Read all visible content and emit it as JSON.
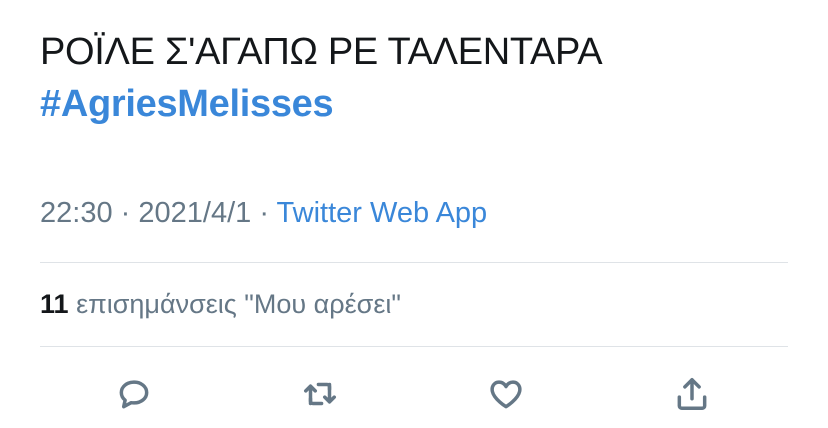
{
  "tweet": {
    "text_line1": "ΡΟΪΛΕ Σ'ΑΓΑΠΩ ΡΕ ΤΑΛΕΝΤΑΡΑ",
    "hashtag": "#AgriesMelisses",
    "time": "22:30",
    "separator": "·",
    "date": "2021/4/1",
    "source": "Twitter Web App"
  },
  "likes": {
    "count": "11",
    "label": "επισημάνσεις \"Μου αρέσει\""
  },
  "actions": {
    "reply_icon": "reply-icon",
    "retweet_icon": "retweet-icon",
    "like_icon": "heart-icon",
    "share_icon": "share-icon"
  },
  "colors": {
    "link": "#3a87d9",
    "text": "#14171a",
    "secondary": "#657786",
    "divider": "#dfe3e7"
  }
}
